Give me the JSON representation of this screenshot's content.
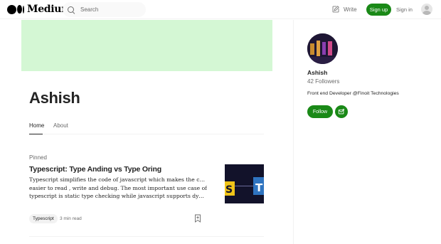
{
  "header": {
    "logo_text": "Medium",
    "search_placeholder": "Search",
    "write_label": "Write",
    "signup_label": "Sign up",
    "signin_label": "Sign in"
  },
  "profile": {
    "name": "Ashish",
    "cover_color": "#d4f7d4",
    "tabs": [
      {
        "label": "Home",
        "active": true
      },
      {
        "label": "About",
        "active": false
      }
    ]
  },
  "pinned_post": {
    "section_label": "Pinned",
    "title": "Typescript: Type Anding vs Type Oring",
    "excerpt_lines": [
      "Typescript simplifies the code of javascript which makes the code",
      "easier to read , write and debug. The most important use case of",
      "typescript is static type checking while javascript supports dynamic…"
    ],
    "tag": "Typescript",
    "read_time": "3 min read"
  },
  "sidebar": {
    "name": "Ashish",
    "followers": "42 Followers",
    "bio": "Front end Developer @Finoit Technologies",
    "follow_label": "Follow"
  },
  "colors": {
    "brand_green": "#1a8917",
    "text": "#242424",
    "muted": "#6b6b6b"
  },
  "icons": [
    "search-icon",
    "write-icon",
    "user-icon",
    "bookmark-icon",
    "subscribe-mail-icon"
  ]
}
